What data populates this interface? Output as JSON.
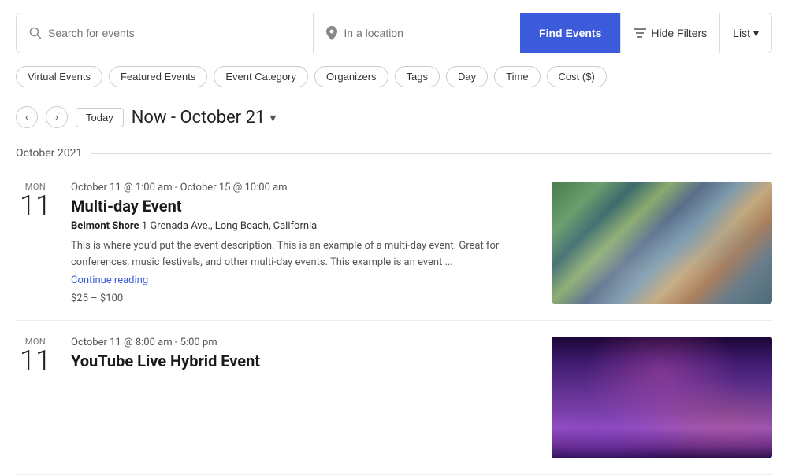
{
  "search": {
    "placeholder": "Search for events",
    "location_placeholder": "In a location",
    "find_button": "Find Events",
    "hide_filters": "Hide Filters",
    "list_label": "List"
  },
  "filters": [
    "Virtual Events",
    "Featured Events",
    "Event Category",
    "Organizers",
    "Tags",
    "Day",
    "Time",
    "Cost ($)"
  ],
  "date_nav": {
    "today_label": "Today",
    "date_range": "Now - October 21"
  },
  "month_section": {
    "label": "October 2021"
  },
  "events": [
    {
      "day_name": "MON",
      "day_num": "11",
      "time": "October 11 @ 1:00 am - October 15 @ 10:00 am",
      "title": "Multi-day Event",
      "location_name": "Belmont Shore",
      "location_address": "1 Grenada Ave., Long Beach, California",
      "description": "This is where you'd put the event description. This is an example of a multi-day event. Great for conferences, music festivals, and other multi-day events. This example is an event ...",
      "continue_reading": "Continue reading",
      "price": "$25 – $100",
      "image_type": "crowd"
    },
    {
      "day_name": "MON",
      "day_num": "11",
      "time": "October 11 @ 8:00 am - 5:00 pm",
      "title": "YouTube Live Hybrid Event",
      "location_name": "",
      "location_address": "",
      "description": "",
      "continue_reading": "",
      "price": "",
      "image_type": "concert"
    }
  ]
}
